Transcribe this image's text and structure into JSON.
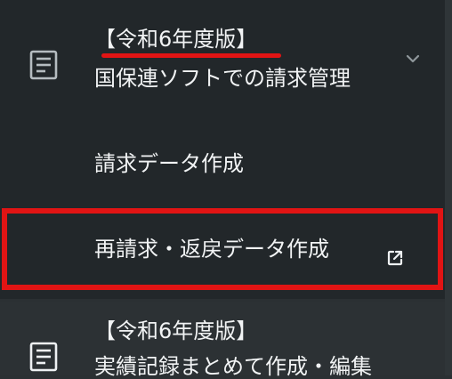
{
  "menu": {
    "items": [
      {
        "year": "【令和6年度版】",
        "label": "国保連ソフトでの請求管理",
        "icon": "document-icon",
        "expand_icon": "chevron-down-icon"
      },
      {
        "label": "請求データ作成"
      },
      {
        "label": "再請求・返戻データ作成",
        "icon": "external-link-icon"
      },
      {
        "year": "【令和6年度版】",
        "label": "実績記録まとめて作成・編集",
        "icon": "document-icon"
      }
    ]
  },
  "colors": {
    "background": "#22272a",
    "text": "#f1f3f4",
    "highlight": "#e11414",
    "icon": "#b5bcc0"
  }
}
